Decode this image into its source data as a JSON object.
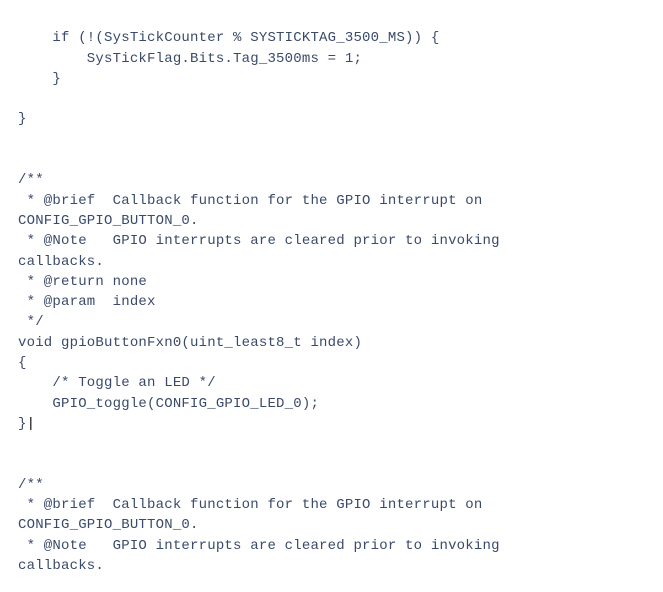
{
  "code": {
    "l01": "    if (!(SysTickCounter % SYSTICKTAG_3500_MS)) {",
    "l02": "        SysTickFlag.Bits.Tag_3500ms = 1;",
    "l03": "    }",
    "l04": "",
    "l05": "}",
    "l06": "",
    "l07": "",
    "l08": "/**",
    "l09": " * @brief  Callback function for the GPIO interrupt on",
    "l10": "CONFIG_GPIO_BUTTON_0.",
    "l11": " * @Note   GPIO interrupts are cleared prior to invoking",
    "l12": "callbacks.",
    "l13": " * @return none",
    "l14": " * @param  index",
    "l15": " */",
    "l16": "void gpioButtonFxn0(uint_least8_t index)",
    "l17": "{",
    "l18": "    /* Toggle an LED */",
    "l19": "    GPIO_toggle(CONFIG_GPIO_LED_0);",
    "l20": "}",
    "l21": "",
    "l22": "",
    "l23": "/**",
    "l24": " * @brief  Callback function for the GPIO interrupt on",
    "l25": "CONFIG_GPIO_BUTTON_0.",
    "l26": " * @Note   GPIO interrupts are cleared prior to invoking",
    "l27": "callbacks.",
    "cursor": "|"
  }
}
